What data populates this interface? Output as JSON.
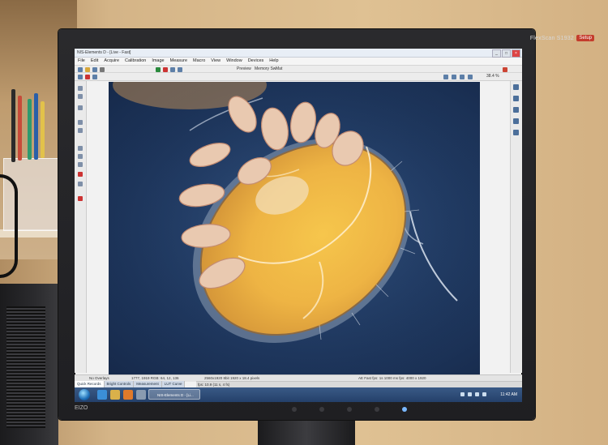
{
  "monitor": {
    "brand_model": "FlexScan S1932",
    "badge": "Setup",
    "bottom_brand": "EIZO"
  },
  "app": {
    "title": "NIS-Elements D - [Live - Fast]",
    "menu": [
      "File",
      "Edit",
      "Acquire",
      "Calibration",
      "Image",
      "Measure",
      "Macro",
      "View",
      "Window",
      "Devices",
      "Help"
    ],
    "toolbar_items": [
      "Preview",
      "Memory Sw",
      "Mat"
    ],
    "zoom": "38.4 %",
    "status_left": "No Overlays",
    "status_mid": "1777, 1919 RGB: 64, 12, 136",
    "status_res": "2560x1920 8bit 1920 x 18.4 pixels",
    "status_fps": "fps: 10.9 (11 s, 4 fs)",
    "status_right": "AE  Fast fps: 1s  1000 ms fps: 4000 x 1920",
    "tabs": [
      "Quick Records",
      "Bright Controls",
      "Measurement",
      "LUT Curve"
    ]
  },
  "taskbar": {
    "task_label": "NIS-Elements D - [Li...",
    "clock": "11:42 AM"
  },
  "image": {
    "subject": "mite specimen under microscope"
  }
}
